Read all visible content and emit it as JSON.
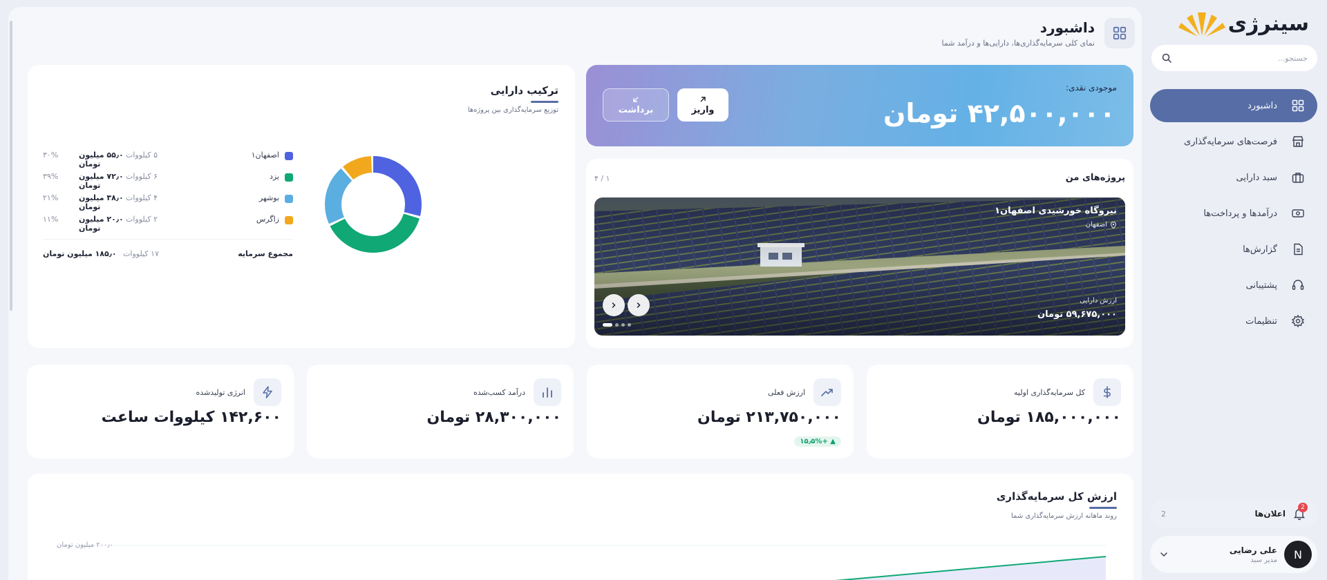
{
  "brand": {
    "name": "سینرژی"
  },
  "search": {
    "placeholder": "جستجو..."
  },
  "nav": [
    {
      "label": "داشبورد",
      "icon": "grid-icon",
      "active": true
    },
    {
      "label": "فرصت‌های سرمایه‌گذاری",
      "icon": "store-icon"
    },
    {
      "label": "سبد دارایی",
      "icon": "briefcase-icon"
    },
    {
      "label": "درآمدها و پرداخت‌ها",
      "icon": "cash-icon"
    },
    {
      "label": "گزارش‌ها",
      "icon": "document-icon"
    },
    {
      "label": "پشتیبانی",
      "icon": "headset-icon"
    },
    {
      "label": "تنظیمات",
      "icon": "gear-icon"
    }
  ],
  "notifications": {
    "label": "اعلان‌ها",
    "badge": "2",
    "count": "2"
  },
  "user": {
    "initial": "N",
    "name": "علی رضایی",
    "role": "مدیر سبد"
  },
  "page": {
    "title": "داشبورد",
    "subtitle": "نمای کلی سرمایه‌گذاری‌ها، دارایی‌ها و درآمد شما"
  },
  "balance": {
    "label": "موجودی نقدی:",
    "value": "۴۲,۵۰۰,۰۰۰ تومان",
    "deposit": "واریز",
    "withdraw": "برداشت"
  },
  "projects": {
    "title": "پروژه‌های من",
    "counter": "۱ / ۴",
    "current": {
      "name": "نیروگاه خورشیدی اصفهان۱",
      "location": "اصفهان",
      "value_label": "ارزش دارایی",
      "value": "۵۹,۶۷۵,۰۰۰ تومان"
    },
    "slides": 4,
    "active_slide": 1
  },
  "assets": {
    "title": "ترکیب دارایی",
    "subtitle": "توزیع سرمایه‌گذاری بین پروژه‌ها",
    "items": [
      {
        "name": "اصفهان۱",
        "kw": "۵ کیلووات",
        "amount": "۵۵٫۰ میلیون تومان",
        "pct": "۳۰%",
        "share": 30,
        "color": "#4f63e0"
      },
      {
        "name": "یزد",
        "kw": "۶ کیلووات",
        "amount": "۷۲٫۰ میلیون تومان",
        "pct": "۳۹%",
        "share": 39,
        "color": "#10a874"
      },
      {
        "name": "بوشهر",
        "kw": "۴ کیلووات",
        "amount": "۳۸٫۰ میلیون تومان",
        "pct": "۲۱%",
        "share": 21,
        "color": "#5aaee0"
      },
      {
        "name": "زاگرس",
        "kw": "۲ کیلووات",
        "amount": "۲۰٫۰ میلیون تومان",
        "pct": "۱۱%",
        "share": 11,
        "color": "#f2a81d"
      }
    ],
    "total_label": "مجموع سرمایه",
    "total_kw": "۱۷ کیلووات",
    "total_amount": "۱۸۵٫۰ میلیون تومان"
  },
  "stats": [
    {
      "label": "کل سرمایه‌گذاری اولیه",
      "value": "۱۸۵,۰۰۰,۰۰۰ تومان",
      "icon": "dollar-icon"
    },
    {
      "label": "ارزش فعلی",
      "value": "۲۱۳,۷۵۰,۰۰۰ تومان",
      "icon": "trend-up-icon",
      "delta": "▲ +۱۵٫۵%"
    },
    {
      "label": "درآمد کسب‌شده",
      "value": "۲۸,۳۰۰,۰۰۰ تومان",
      "icon": "bar-chart-icon"
    },
    {
      "label": "انرژی تولیدشده",
      "value": "۱۴۲,۶۰۰ کیلووات ساعت",
      "icon": "lightning-icon"
    }
  ],
  "value_chart": {
    "title": "ارزش کل سرمایه‌گذاری",
    "subtitle": "روند ماهانه ارزش سرمایه‌گذاری شما",
    "y_tick": "۲۰۰٫۰ میلیون تومان",
    "line_color": "#10a874",
    "fill_color": "#e7e9fb"
  }
}
